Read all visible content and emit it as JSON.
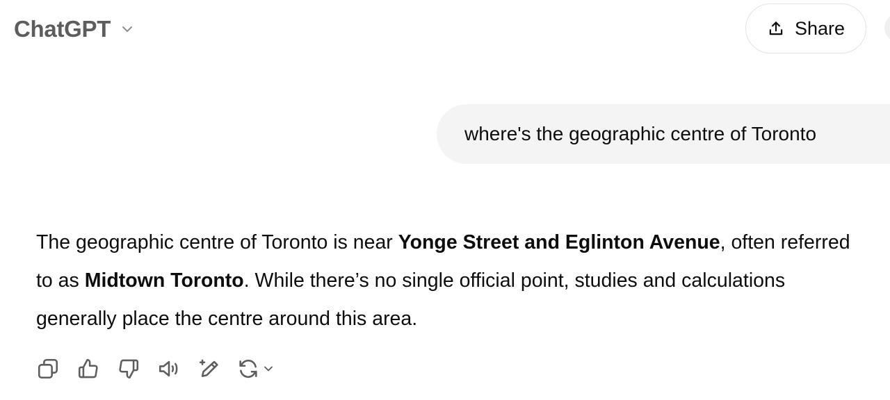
{
  "header": {
    "model_name": "ChatGPT",
    "model_chevron_icon": "chevron-down-icon",
    "share_label": "Share",
    "share_icon": "share-upload-icon"
  },
  "conversation": {
    "user_message": "where's the geographic centre of Toronto",
    "assistant_message": {
      "part1": "The geographic centre of Toronto is near ",
      "bold1": "Yonge Street and Eglinton Avenue",
      "part2": ", often referred to as ",
      "bold2": "Midtown Toronto",
      "part3": ". While there’s no single official point, studies and calculations generally place the centre around this area."
    }
  },
  "actions": [
    {
      "name": "copy-icon"
    },
    {
      "name": "thumbs-up-icon"
    },
    {
      "name": "thumbs-down-icon"
    },
    {
      "name": "read-aloud-icon"
    },
    {
      "name": "edit-sparkle-icon"
    },
    {
      "name": "regenerate-icon"
    }
  ],
  "colors": {
    "text_primary": "#0d0d0d",
    "text_secondary": "#5d5d5d",
    "bubble_bg": "#f4f4f4",
    "border": "#e3e3e3"
  }
}
